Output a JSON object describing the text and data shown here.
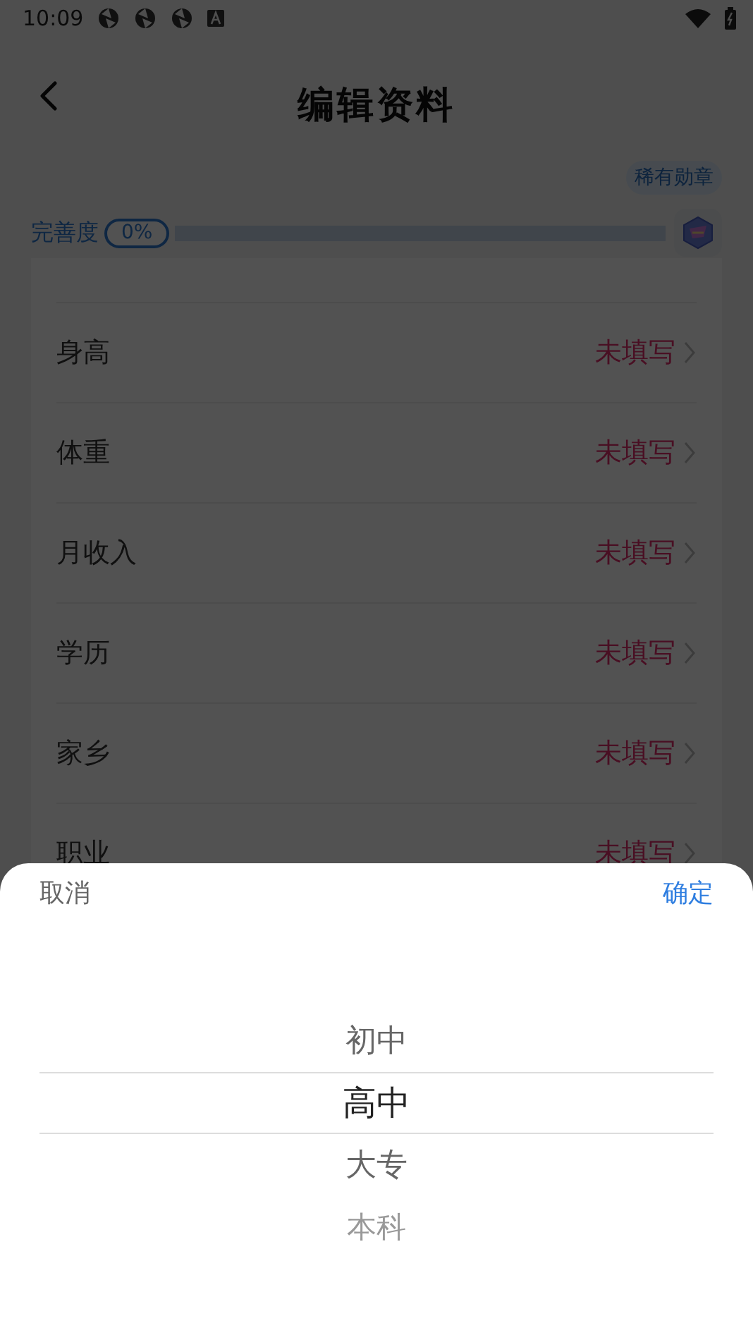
{
  "status_bar": {
    "time": "10:09"
  },
  "header": {
    "title": "编辑资料"
  },
  "completeness": {
    "badge": "稀有勋章",
    "label": "完善度",
    "percent": "0%",
    "level": 0
  },
  "rows": [
    {
      "label": "身高",
      "value": "未填写"
    },
    {
      "label": "体重",
      "value": "未填写"
    },
    {
      "label": "月收入",
      "value": "未填写"
    },
    {
      "label": "学历",
      "value": "未填写"
    },
    {
      "label": "家乡",
      "value": "未填写"
    },
    {
      "label": "职业",
      "value": "未填写"
    }
  ],
  "picker": {
    "cancel": "取消",
    "confirm": "确定",
    "options": [
      {
        "label": "初中",
        "selected": false
      },
      {
        "label": "高中",
        "selected": true
      },
      {
        "label": "大专",
        "selected": false
      },
      {
        "label": "本科",
        "selected": false
      }
    ]
  }
}
